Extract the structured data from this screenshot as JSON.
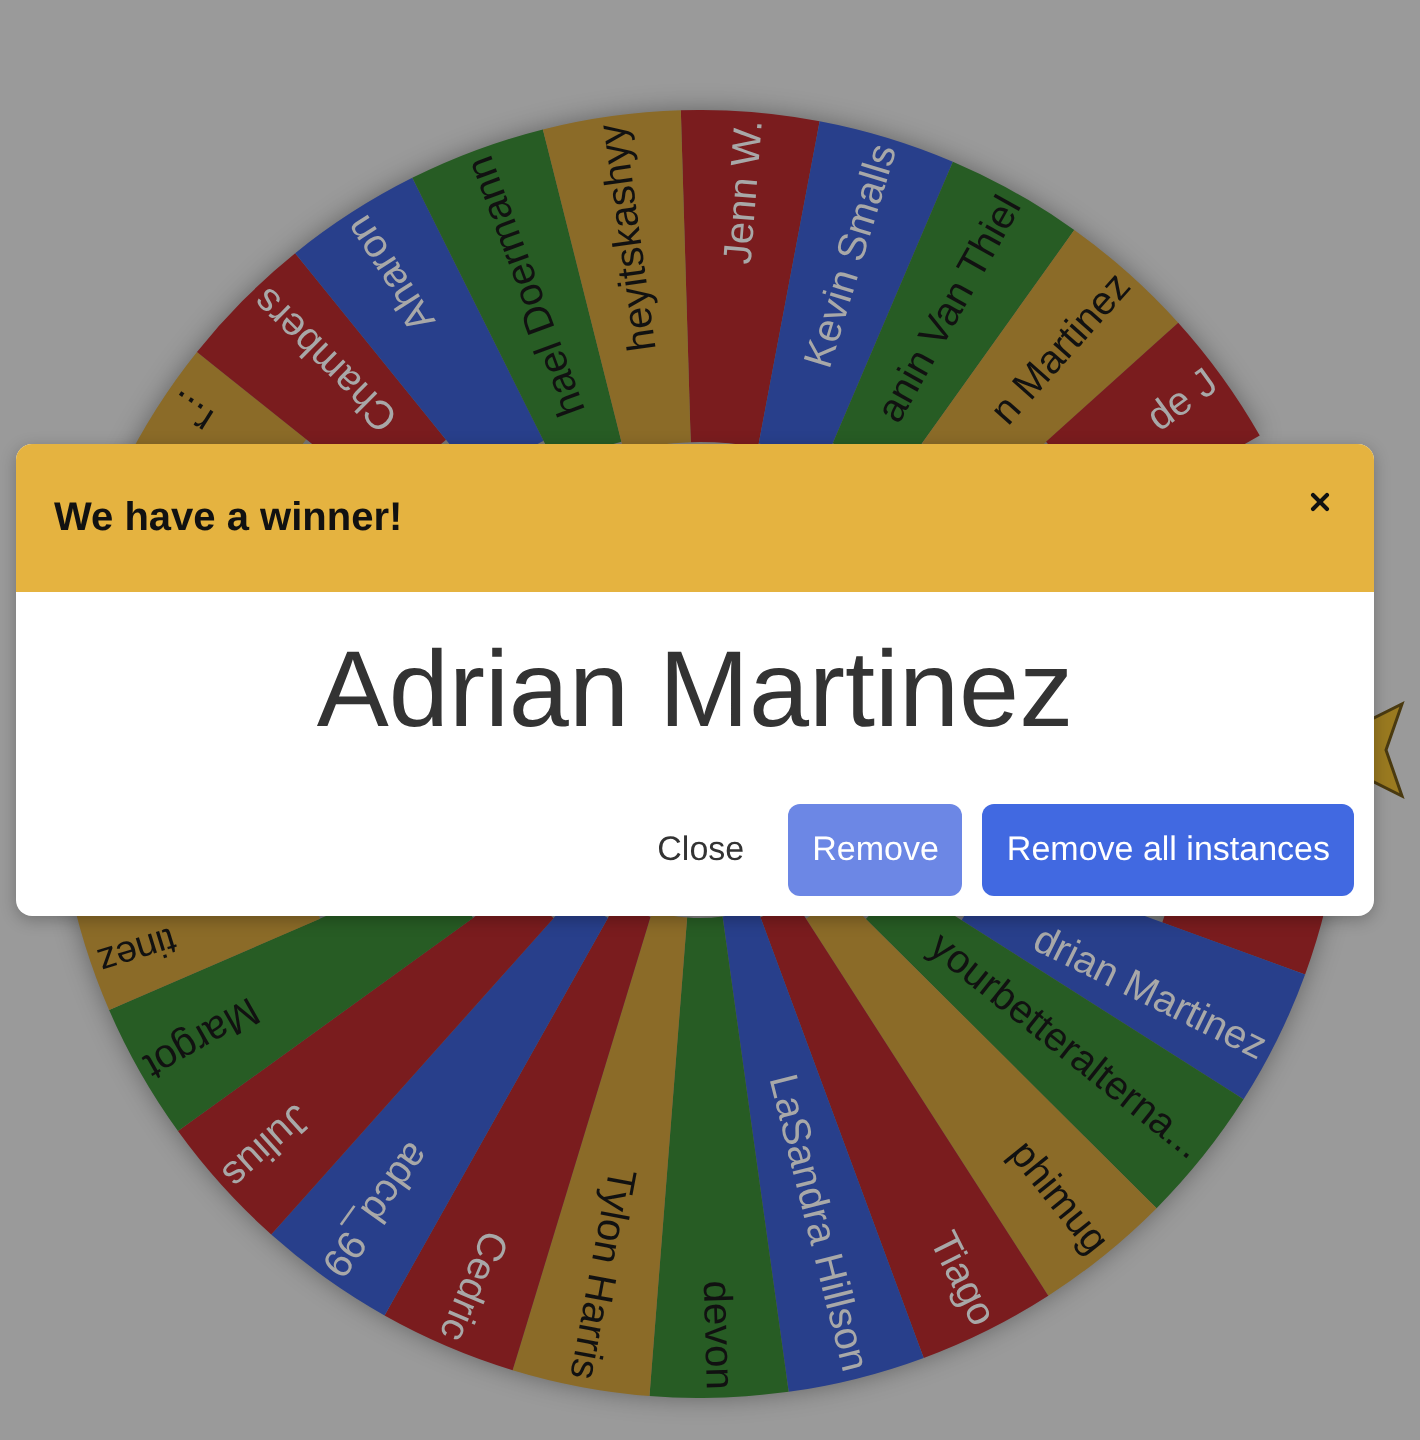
{
  "wheel": {
    "segments": [
      {
        "label": "Jenn W.",
        "color": "#7a1c1e"
      },
      {
        "label": "Kevin Smalls",
        "color": "#283f8b"
      },
      {
        "label": "anin Van Thiel",
        "color": "#275c24"
      },
      {
        "label": "n Martinez",
        "color": "#8b6b28"
      },
      {
        "label": "de J",
        "color": "#7a1c1e"
      },
      {
        "color": "#7a1c1e"
      },
      {
        "label": "drian Martinez",
        "color": "#283f8b"
      },
      {
        "label": "yourbetteralterna...",
        "color": "#275c24"
      },
      {
        "label": "phimug",
        "color": "#8b6b28"
      },
      {
        "label": "Tiago",
        "color": "#7a1c1e"
      },
      {
        "label": "LaSandra Hillson",
        "color": "#283f8b"
      },
      {
        "label": "devon",
        "color": "#275c24"
      },
      {
        "label": "Tylon Harris",
        "color": "#8b6b28"
      },
      {
        "label": "Cedric",
        "color": "#7a1c1e"
      },
      {
        "label": "adcd_99",
        "color": "#283f8b"
      },
      {
        "label": "Julius",
        "color": "#7a1c1e"
      },
      {
        "label": "Margot",
        "color": "#275c24"
      },
      {
        "label": "tinez",
        "color": "#8b6b28"
      },
      {
        "label": "r...",
        "color": "#8b6b28"
      },
      {
        "label": "Chambers",
        "color": "#7a1c1e"
      },
      {
        "label": "Aharon",
        "color": "#283f8b"
      },
      {
        "label": "hael Doermann",
        "color": "#275c24"
      },
      {
        "label": "heyitskashyy",
        "color": "#8b6b28"
      }
    ]
  },
  "dialog": {
    "title": "We have a winner!",
    "winner": "Adrian Martinez",
    "buttons": [
      {
        "label": "Close",
        "kind": "text"
      },
      {
        "label": "Remove",
        "kind": "secondary"
      },
      {
        "label": "Remove all instances",
        "kind": "primary"
      }
    ]
  }
}
